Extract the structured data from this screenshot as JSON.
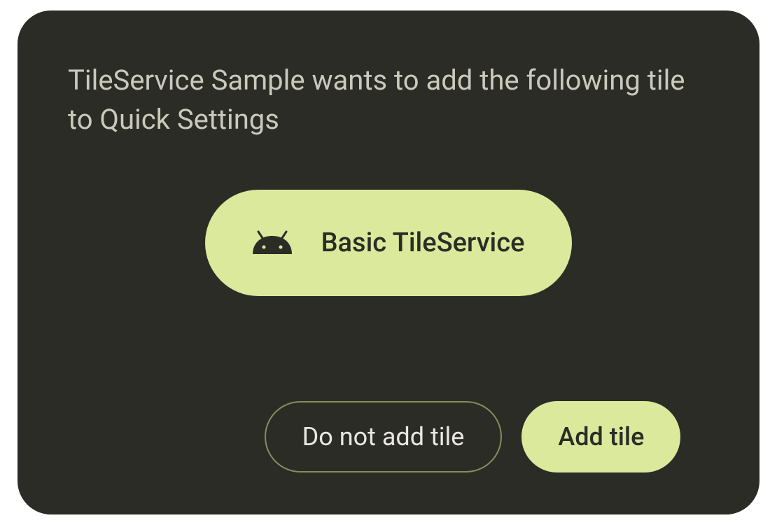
{
  "dialog": {
    "message": "TileService Sample wants to add the following tile to Quick Settings"
  },
  "tile": {
    "label": "Basic TileService",
    "icon": "android-icon"
  },
  "actions": {
    "decline_label": "Do not add tile",
    "accept_label": "Add tile"
  },
  "colors": {
    "background": "#2c2c26",
    "accent": "#dbe99c",
    "text_muted": "#c9c9bc",
    "text_dark": "#2c2c26",
    "border": "#838f5c"
  }
}
